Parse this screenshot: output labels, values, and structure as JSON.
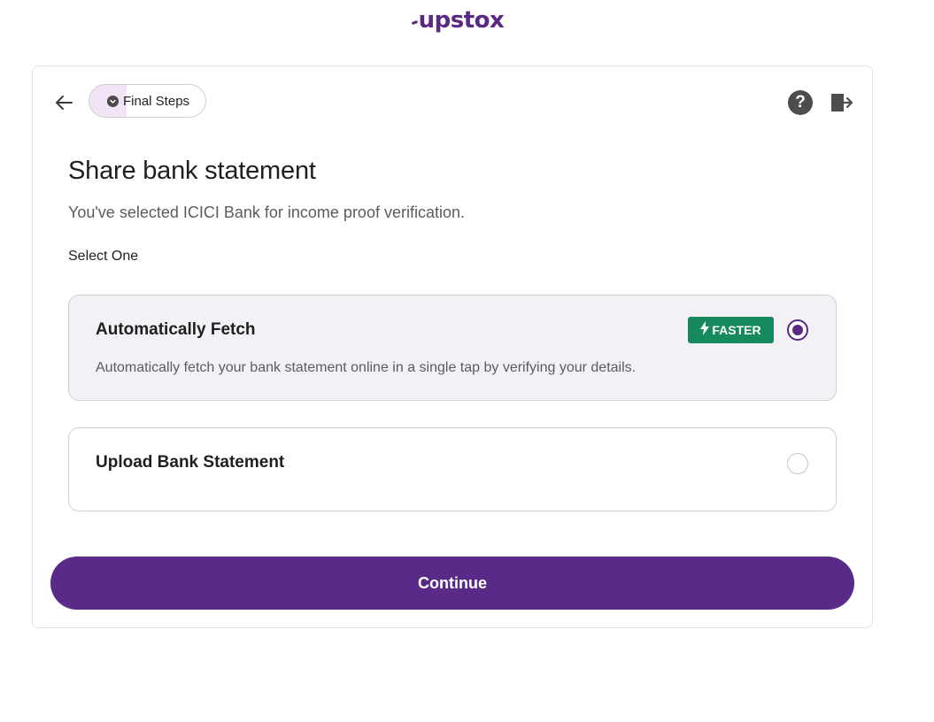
{
  "brand": {
    "logo_text": "upstox",
    "accent_color": "#5a2a82"
  },
  "header": {
    "step_label": "Final Steps",
    "back_icon": "arrow-left-icon",
    "help_icon": "question-circle-icon",
    "help_symbol": "?",
    "exit_icon": "logout-icon"
  },
  "main": {
    "title": "Share bank statement",
    "subtitle": "You've selected ICICI Bank for income proof verification.",
    "select_label": "Select One",
    "options": [
      {
        "title": "Automatically Fetch",
        "badge": "FASTER",
        "badge_icon": "lightning-bolt-icon",
        "badge_color": "#16895e",
        "description": "Automatically fetch your bank statement online in a single tap by verifying your details.",
        "selected": true
      },
      {
        "title": "Upload Bank Statement",
        "selected": false
      }
    ],
    "continue_label": "Continue"
  }
}
